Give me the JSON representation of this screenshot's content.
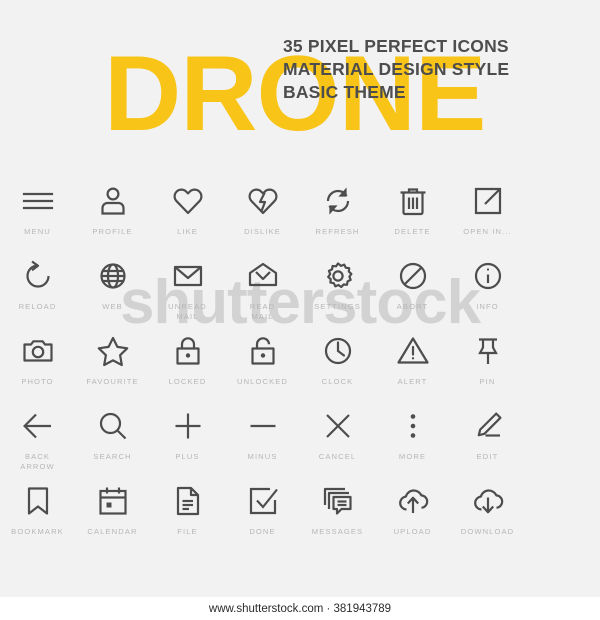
{
  "colors": {
    "background": "#f2f2f2",
    "accent_yellow": "#f8c417",
    "title_gray": "#4d4d4d",
    "icon_gray": "#4d4d4d",
    "label_gray": "#b7b7b7",
    "watermark_gray": "#d3d3d3",
    "footer_background": "#ffffff",
    "footer_text": "#2b2b2b"
  },
  "header": {
    "word": "DRONE",
    "line1": "35 PIXEL PERFECT ICONS",
    "line2": "MATERIAL DESIGN STYLE",
    "line3": "BASIC THEME"
  },
  "watermark": {
    "text": "shutterstock"
  },
  "footer": {
    "text": "www.shutterstock.com · 381943789"
  },
  "grid": {
    "columns": 7,
    "rows": 5,
    "icons": [
      {
        "icon": "menu-icon",
        "label": "MENU"
      },
      {
        "icon": "profile-icon",
        "label": "PROFILE"
      },
      {
        "icon": "like-icon",
        "label": "LIKE"
      },
      {
        "icon": "dislike-icon",
        "label": "DISLIKE"
      },
      {
        "icon": "refresh-icon",
        "label": "REFRESH"
      },
      {
        "icon": "delete-icon",
        "label": "DELETE"
      },
      {
        "icon": "open-in-icon",
        "label": "OPEN IN..."
      },
      {
        "icon": "reload-icon",
        "label": "RELOAD"
      },
      {
        "icon": "web-icon",
        "label": "WEB"
      },
      {
        "icon": "unread-mail-icon",
        "label": "UNREAD\nMAIL"
      },
      {
        "icon": "read-mail-icon",
        "label": "READ\nMAIL"
      },
      {
        "icon": "settings-icon",
        "label": "SETTINGS"
      },
      {
        "icon": "abort-icon",
        "label": "ABORT"
      },
      {
        "icon": "info-icon",
        "label": "INFO"
      },
      {
        "icon": "photo-icon",
        "label": "PHOTO"
      },
      {
        "icon": "favourite-icon",
        "label": "FAVOURITE"
      },
      {
        "icon": "locked-icon",
        "label": "LOCKED"
      },
      {
        "icon": "unlocked-icon",
        "label": "UNLOCKED"
      },
      {
        "icon": "clock-icon",
        "label": "CLOCK"
      },
      {
        "icon": "alert-icon",
        "label": "ALERT"
      },
      {
        "icon": "pin-icon",
        "label": "PIN"
      },
      {
        "icon": "back-arrow-icon",
        "label": "BACK\nARROW"
      },
      {
        "icon": "search-icon",
        "label": "SEARCH"
      },
      {
        "icon": "plus-icon",
        "label": "PLUS"
      },
      {
        "icon": "minus-icon",
        "label": "MINUS"
      },
      {
        "icon": "cancel-icon",
        "label": "CANCEL"
      },
      {
        "icon": "more-icon",
        "label": "MORE"
      },
      {
        "icon": "edit-icon",
        "label": "EDIT"
      },
      {
        "icon": "bookmark-icon",
        "label": "BOOKMARK"
      },
      {
        "icon": "calendar-icon",
        "label": "CALENDAR"
      },
      {
        "icon": "file-icon",
        "label": "FILE"
      },
      {
        "icon": "done-icon",
        "label": "DONE"
      },
      {
        "icon": "messages-icon",
        "label": "MESSAGES"
      },
      {
        "icon": "upload-icon",
        "label": "UPLOAD"
      },
      {
        "icon": "download-icon",
        "label": "DOWNLOAD"
      }
    ]
  }
}
